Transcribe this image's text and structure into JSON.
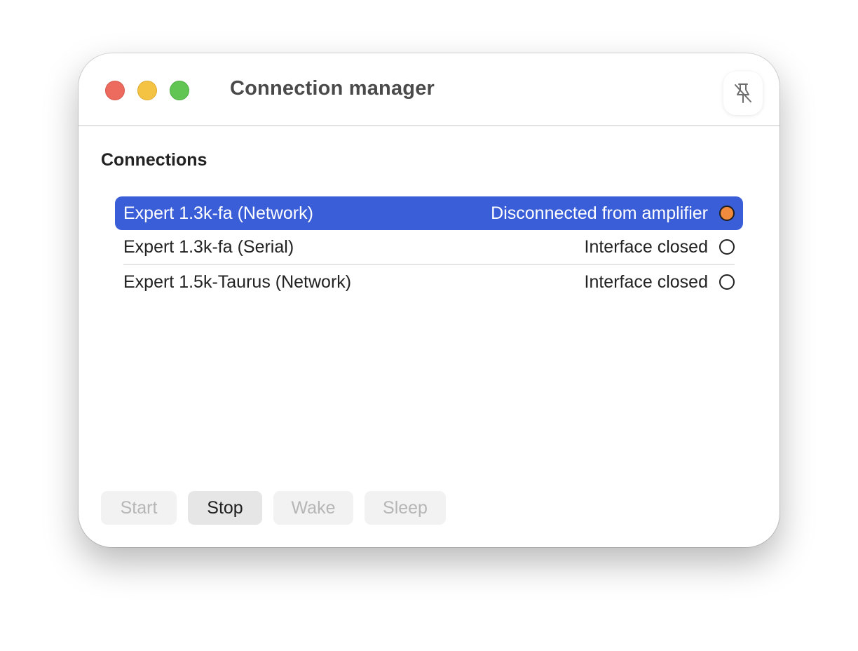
{
  "window": {
    "title": "Connection manager",
    "pin_icon": "pin-slash-icon"
  },
  "connections": {
    "heading": "Connections",
    "rows": [
      {
        "name": "Expert 1.3k-fa (Network)",
        "status": "Disconnected from amplifier",
        "indicator": "orange",
        "selected": true
      },
      {
        "name": "Expert 1.3k-fa (Serial)",
        "status": "Interface closed",
        "indicator": "empty",
        "selected": false
      },
      {
        "name": "Expert 1.5k-Taurus (Network)",
        "status": "Interface closed",
        "indicator": "empty",
        "selected": false
      }
    ]
  },
  "toolbar": {
    "start_label": "Start",
    "stop_label": "Stop",
    "wake_label": "Wake",
    "sleep_label": "Sleep",
    "enabled": [
      "Stop"
    ]
  },
  "colors": {
    "selection": "#3a5ed8",
    "status_orange": "#f08b3e",
    "close": "#ed6a5e",
    "minimize": "#f5c344",
    "zoom": "#61c554"
  }
}
